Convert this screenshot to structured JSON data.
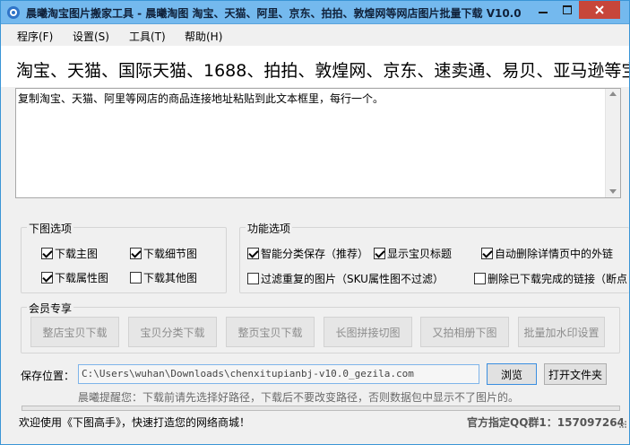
{
  "window": {
    "title": "晨曦淘宝图片搬家工具 - 晨曦淘图 淘宝、天猫、阿里、京东、拍拍、敦煌网等网店图片批量下载 V10.0",
    "controls": {
      "minimize": "minimize",
      "maximize": "maximize",
      "close": "close"
    }
  },
  "menu": {
    "items": [
      "程序(F)",
      "设置(S)",
      "工具(T)",
      "帮助(H)"
    ]
  },
  "banner": {
    "text": "淘宝、天猫、国际天猫、1688、拍拍、敦煌网、京东、速卖通、易贝、亚马逊等宝"
  },
  "input_area": {
    "text": "复制淘宝、天猫、阿里等网店的商品连接地址粘贴到此文本框里，每行一个。"
  },
  "download_options": {
    "title": "下图选项",
    "items": [
      {
        "label": "下载主图",
        "checked": true
      },
      {
        "label": "下载细节图",
        "checked": true
      },
      {
        "label": "下载属性图",
        "checked": true
      },
      {
        "label": "下载其他图",
        "checked": false
      }
    ]
  },
  "function_options": {
    "title": "功能选项",
    "items": [
      {
        "label": "智能分类保存（推荐）",
        "checked": true
      },
      {
        "label": "显示宝贝标题",
        "checked": true
      },
      {
        "label": "自动删除详情页中的外链",
        "checked": true
      },
      {
        "label": "过滤重复的图片（SKU属性图不过滤）",
        "checked": false
      },
      {
        "label": "删除已下载完成的链接（断点",
        "checked": false
      }
    ]
  },
  "member": {
    "title": "会员专享",
    "buttons": [
      "整店宝贝下载",
      "宝贝分类下载",
      "整页宝贝下载",
      "长图拼接切图",
      "又拍相册下图",
      "批量加水印设置"
    ]
  },
  "save": {
    "label": "保存位置：",
    "path": "C:\\Users\\wuhan\\Downloads\\chenxitupianbj-v10.0_gezila.com",
    "browse": "浏览",
    "open_folder": "打开文件夹",
    "hint": "晨曦提醒您：下载前请先选择好路径，下载后不要改变路径，否则数据包中显示不了图片的。"
  },
  "status": {
    "left": "欢迎使用《下图高手》，快速打造您的网络商城！",
    "right": "官方指定QQ群1：157097264"
  },
  "colors": {
    "titlebar": "#74b9ee",
    "close_button": "#c7463a"
  }
}
